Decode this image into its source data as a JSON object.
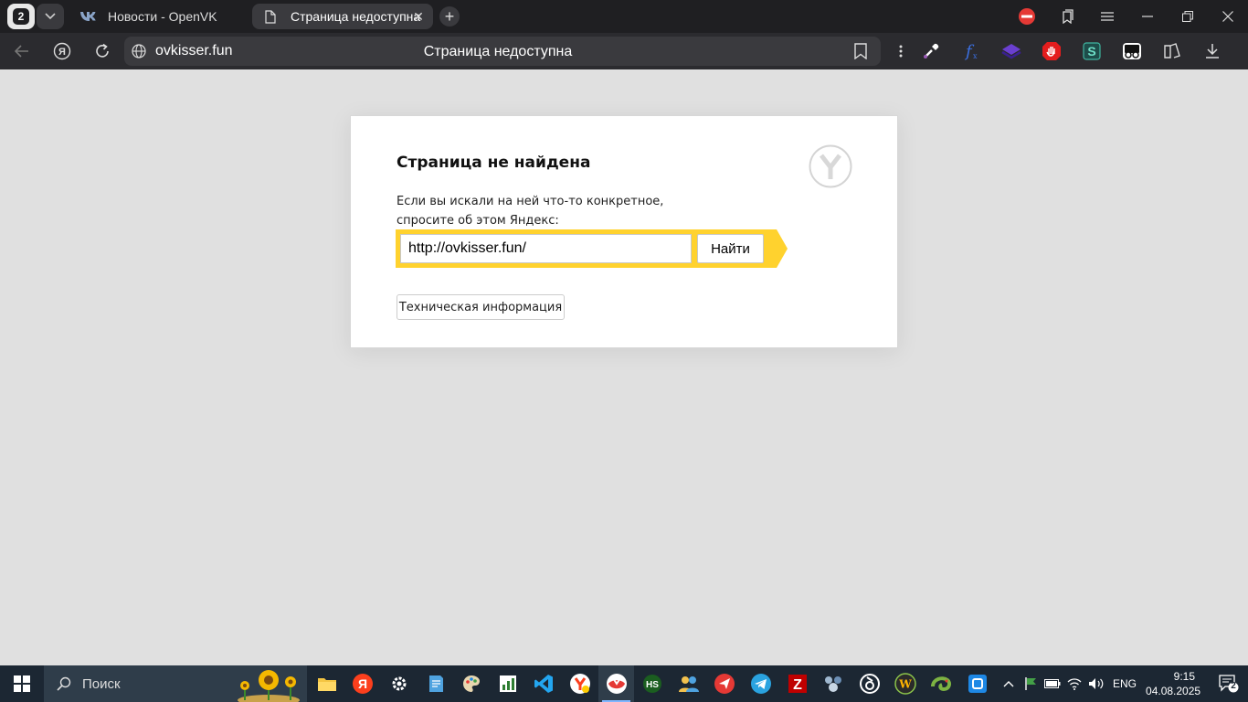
{
  "browser": {
    "tab_count": "2",
    "tabs": [
      {
        "title": "Новости - OpenVK",
        "active": false
      },
      {
        "title": "Страница недоступна",
        "active": true
      }
    ],
    "address": {
      "host": "ovkisser.fun",
      "page_title": "Страница недоступна"
    },
    "extensions": [
      "eyedropper-icon",
      "fx-icon",
      "layers-icon",
      "adblock-hand-icon",
      "s-extension-icon",
      "glasses-icon",
      "collections-icon",
      "download-icon"
    ]
  },
  "error_page": {
    "title": "Страница не найдена",
    "text_line1": "Если вы искали на ней что-то конкретное,",
    "text_line2": "спросите об этом Яндекс:",
    "search_value": "http://ovkisser.fun/",
    "search_button": "Найти",
    "tech_button": "Техническая информация"
  },
  "taskbar": {
    "search_label": "Поиск",
    "apps": [
      "file-explorer-icon",
      "yandex-icon",
      "settings-icon",
      "notepad-icon",
      "paint-icon",
      "chart-icon",
      "vscode-icon",
      "yandex-music-icon",
      "yandex-browser-icon",
      "hs-icon",
      "people-icon",
      "red-arrow-icon",
      "telegram-icon",
      "filezilla-icon",
      "network-icon",
      "delta-icon",
      "wordpress-icon",
      "chameleon-icon",
      "blue-square-icon"
    ],
    "lang": "ENG",
    "time": "9:15",
    "date": "04.08.2025",
    "notifications": "2"
  }
}
